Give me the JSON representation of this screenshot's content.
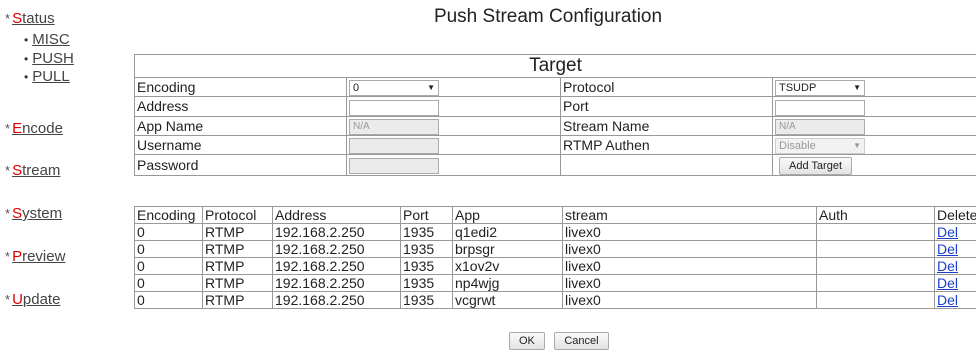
{
  "page_title": "Push Stream Configuration",
  "sidebar": {
    "items": [
      {
        "prefix": "S",
        "rest": "tatus"
      },
      {
        "prefix": "E",
        "rest": "ncode"
      },
      {
        "prefix": "S",
        "rest": "tream"
      },
      {
        "prefix": "S",
        "rest": "ystem"
      },
      {
        "prefix": "P",
        "rest": "review"
      },
      {
        "prefix": "U",
        "rest": "pdate"
      }
    ],
    "status_sub": [
      "MISC",
      "PUSH",
      "PULL"
    ]
  },
  "target": {
    "title": "Target",
    "encoding_label": "Encoding",
    "encoding_value": "0",
    "protocol_label": "Protocol",
    "protocol_value": "TSUDP",
    "address_label": "Address",
    "port_label": "Port",
    "app_name_label": "App Name",
    "app_name_value": "N/A",
    "stream_name_label": "Stream Name",
    "stream_name_value": "N/A",
    "username_label": "Username",
    "rtmp_authen_label": "RTMP Authen",
    "rtmp_authen_value": "Disable",
    "password_label": "Password",
    "add_target_label": "Add Target"
  },
  "list": {
    "headers": [
      "Encoding",
      "Protocol",
      "Address",
      "Port",
      "App",
      "stream",
      "Auth",
      "Delete"
    ],
    "rows": [
      {
        "encoding": "0",
        "protocol": "RTMP",
        "address": "192.168.2.250",
        "port": "1935",
        "app": "q1edi2",
        "stream": "livex0",
        "auth": "",
        "del": "Del"
      },
      {
        "encoding": "0",
        "protocol": "RTMP",
        "address": "192.168.2.250",
        "port": "1935",
        "app": "brpsgr",
        "stream": "livex0",
        "auth": "",
        "del": "Del"
      },
      {
        "encoding": "0",
        "protocol": "RTMP",
        "address": "192.168.2.250",
        "port": "1935",
        "app": "x1ov2v",
        "stream": "livex0",
        "auth": "",
        "del": "Del"
      },
      {
        "encoding": "0",
        "protocol": "RTMP",
        "address": "192.168.2.250",
        "port": "1935",
        "app": "np4wjg",
        "stream": "livex0",
        "auth": "",
        "del": "Del"
      },
      {
        "encoding": "0",
        "protocol": "RTMP",
        "address": "192.168.2.250",
        "port": "1935",
        "app": "vcgrwt",
        "stream": "livex0",
        "auth": "",
        "del": "Del"
      }
    ]
  },
  "actions": {
    "ok": "OK",
    "cancel": "Cancel"
  },
  "colors": {
    "nav_accent": "#dd0000",
    "link": "#1a3fcc"
  }
}
